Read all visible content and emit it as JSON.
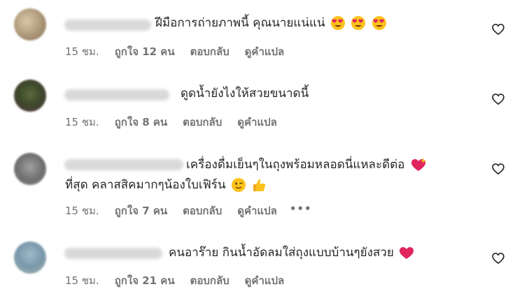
{
  "comments": [
    {
      "text": "ฝีมือการถ่ายภาพนี้ คุณนายแน่แน่",
      "text2": "",
      "time": "15 ชม.",
      "likes": "ถูกใจ 12 คน",
      "reply": "ตอบกลับ",
      "translate": "ดูคำแปล",
      "emojis": [
        "heart-eyes-emoji",
        "heart-eyes-emoji",
        "heart-eyes-emoji"
      ]
    },
    {
      "text": "ดูดน้ำยังไงให้สวยขนาดนี้",
      "text2": "",
      "time": "15 ชม.",
      "likes": "ถูกใจ 8 คน",
      "reply": "ตอบกลับ",
      "translate": "ดูคำแปล",
      "emojis": []
    },
    {
      "text": "เครื่องดื่มเย็นๆในถุงพร้อมหลอดนี่แหละดีต่อ",
      "text2": "ที่สุด คลาสสิคมากๆน้องใบเฟิร์น",
      "time": "15 ชม.",
      "likes": "ถูกใจ 7 คน",
      "reply": "ตอบกลับ",
      "translate": "ดูคำแปล",
      "more": "•••",
      "emojis": [
        "sparkling-heart-emoji",
        "wink-emoji",
        "thumbs-up-emoji"
      ]
    },
    {
      "text": "คนอาร๊าย กินน้ำอัดลมใส่ถุงแบบบ้านๆยังสวย",
      "text2": "",
      "time": "15 ชม.",
      "likes": "ถูกใจ 21 คน",
      "reply": "ตอบกลับ",
      "translate": "ดูคำแปล",
      "emojis": [
        "red-heart-emoji"
      ]
    }
  ],
  "colors": {
    "text": "#262626",
    "meta": "#737373",
    "heart_emoji": "#e0245e"
  }
}
